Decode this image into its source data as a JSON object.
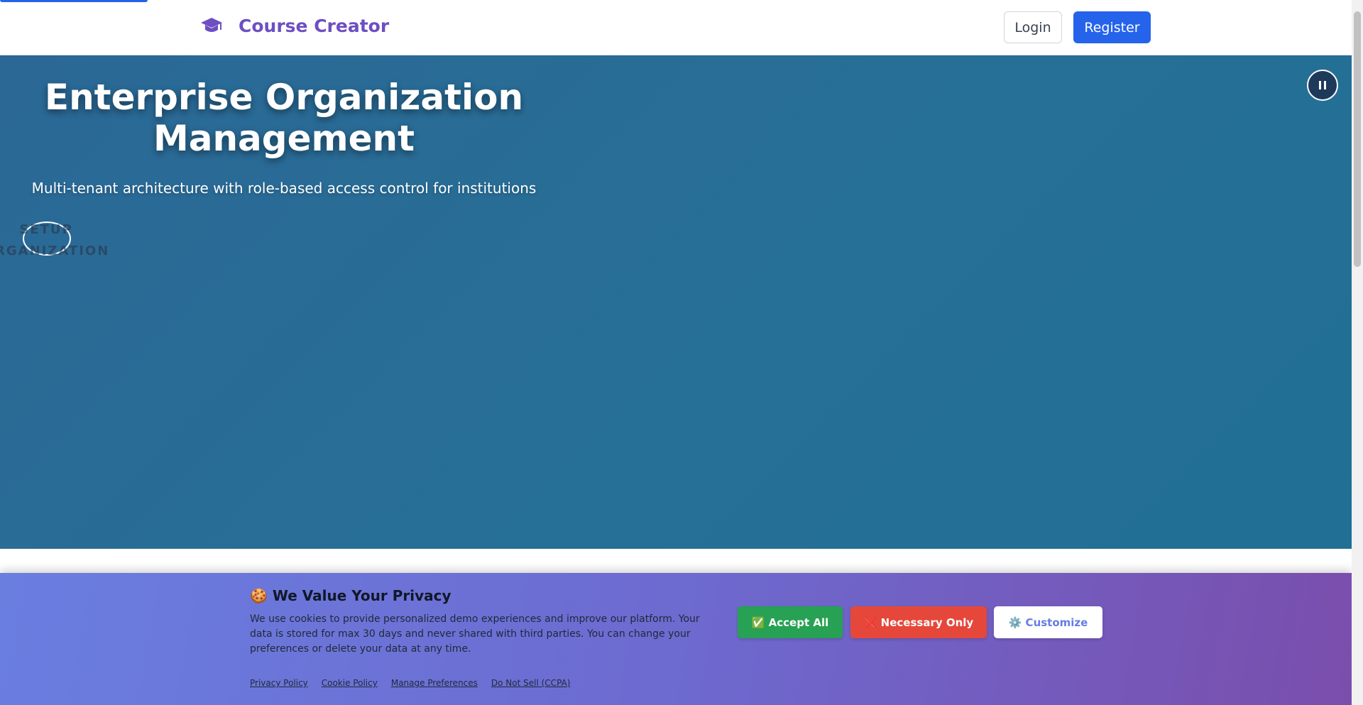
{
  "nav": {
    "brand_icon": "graduation-cap-icon",
    "brand_title": "Course Creator",
    "login_label": "Login",
    "register_label": "Register"
  },
  "hero": {
    "title": "Enterprise Organization Management",
    "subtitle": "Multi-tenant architecture with role-based access control for institutions",
    "cta_label": "SETUP ORGANIZATION",
    "pause_icon": "pause-icon"
  },
  "cookie": {
    "title": "🍪 We Value Your Privacy",
    "text": "We use cookies to provide personalized demo experiences and improve our platform. Your data is stored for max 30 days and never shared with third parties. You can change your preferences or delete your data at any time.",
    "accept_label": "✅ Accept All",
    "necessary_label": "❌ Necessary Only",
    "customize_label": "⚙️ Customize",
    "links": [
      "Privacy Policy",
      "Cookie Policy",
      "Manage Preferences",
      "Do Not Sell (CCPA)"
    ]
  },
  "colors": {
    "primary": "#2563eb",
    "brand": "#6d4fc2",
    "hero": "#276f96",
    "accept": "#27a153",
    "necessary": "#e5483a"
  }
}
